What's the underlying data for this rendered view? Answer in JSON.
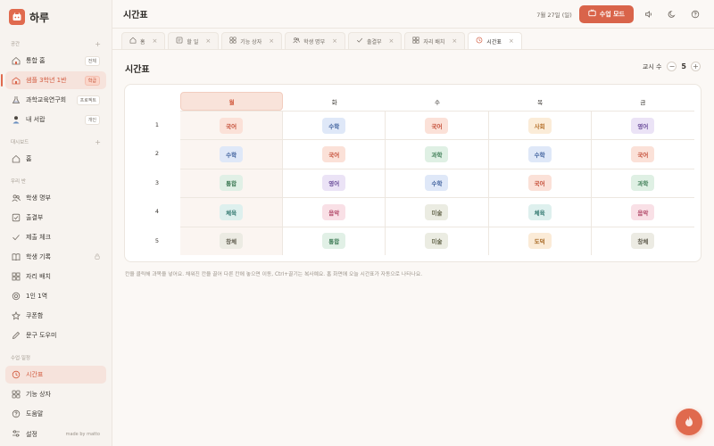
{
  "app": {
    "name": "하루"
  },
  "sidebar": {
    "sections": [
      {
        "title": "공간",
        "items": [
          {
            "label": "통합 홈",
            "tag": "전체",
            "icon": "home-multi-icon"
          },
          {
            "label": "샘플 3학년 1반",
            "tag": "학급",
            "icon": "school-icon"
          },
          {
            "label": "과학교육연구회",
            "tag": "프로젝트",
            "icon": "flask-icon"
          },
          {
            "label": "내 서랍",
            "tag": "개인",
            "icon": "person-icon"
          }
        ]
      },
      {
        "title": "대시보드",
        "items": [
          {
            "label": "홈",
            "icon": "home-icon"
          }
        ]
      },
      {
        "title": "우리 반",
        "items": [
          {
            "label": "학생 명부",
            "icon": "users-icon"
          },
          {
            "label": "출결부",
            "icon": "check-square-icon"
          },
          {
            "label": "제출 체크",
            "icon": "check-icon"
          },
          {
            "label": "학생 기록",
            "icon": "book-icon"
          },
          {
            "label": "자리 배치",
            "icon": "grid-icon"
          },
          {
            "label": "1인 1역",
            "icon": "target-icon"
          },
          {
            "label": "쿠폰함",
            "icon": "star-icon"
          },
          {
            "label": "문구 도우미",
            "icon": "pencil-icon"
          }
        ]
      },
      {
        "title": "수업·일정",
        "items": [
          {
            "label": "시간표",
            "icon": "clock-icon"
          },
          {
            "label": "기능 상자",
            "icon": "apps-icon"
          },
          {
            "label": "도움말",
            "icon": "help-icon"
          }
        ]
      }
    ],
    "footer": {
      "settings": "설정",
      "made_by": "made by matto"
    }
  },
  "topbar": {
    "title": "시간표",
    "date": "7월 27일 (일)",
    "class_mode": "수업 모드"
  },
  "tabs": [
    {
      "label": "홈",
      "icon": "home-icon",
      "active": false
    },
    {
      "label": "할 일",
      "icon": "todo-icon",
      "active": false
    },
    {
      "label": "기능 상자",
      "icon": "apps-icon",
      "active": false
    },
    {
      "label": "학생 명부",
      "icon": "users-icon",
      "active": false
    },
    {
      "label": "출결부",
      "icon": "check-icon",
      "active": false
    },
    {
      "label": "자리 배치",
      "icon": "grid-icon",
      "active": false
    },
    {
      "label": "시간표",
      "icon": "clock-icon",
      "active": true
    }
  ],
  "main": {
    "title": "시간표",
    "period_label": "교시 수",
    "period_count": "5",
    "minus": "−",
    "plus": "+",
    "note": "칸을 클릭해 과목을 넣어요. 채워진 칸을 끌어 다른 칸에 놓으면 이동, Ctrl+끌기는 복사예요. 홈 화면에 오늘 시간표가 자동으로 나타나요."
  },
  "timetable": {
    "days": [
      "월",
      "화",
      "수",
      "목",
      "금"
    ],
    "periods": [
      "1",
      "2",
      "3",
      "4",
      "5"
    ],
    "rows": [
      [
        "국어",
        "수학",
        "국어",
        "사회",
        "영어"
      ],
      [
        "수학",
        "국어",
        "과학",
        "수학",
        "국어"
      ],
      [
        "통합",
        "영어",
        "수학",
        "국어",
        "과학"
      ],
      [
        "체육",
        "음악",
        "미술",
        "체육",
        "음악"
      ],
      [
        "창체",
        "통합",
        "미술",
        "도덕",
        "창체"
      ]
    ]
  },
  "subject_colors": {
    "국어": {
      "bg": "#fbe1d8",
      "fg": "#c5503a"
    },
    "수학": {
      "bg": "#dfe8f8",
      "fg": "#3d5f9c"
    },
    "영어": {
      "bg": "#ebe3f6",
      "fg": "#6b4e9b"
    },
    "사회": {
      "bg": "#fbecd8",
      "fg": "#b5702a"
    },
    "과학": {
      "bg": "#dff0e4",
      "fg": "#3a7a52"
    },
    "통합": {
      "bg": "#e1f0e6",
      "fg": "#3d7a55"
    },
    "체육": {
      "bg": "#def0ee",
      "fg": "#357a72"
    },
    "음악": {
      "bg": "#f9e0e6",
      "fg": "#b04666"
    },
    "미술": {
      "bg": "#ebece2",
      "fg": "#6a6b52"
    },
    "창체": {
      "bg": "#ecebe3",
      "fg": "#5f5c4e"
    },
    "도덕": {
      "bg": "#fbebd7",
      "fg": "#a86a26"
    }
  },
  "colors": {
    "accent": "#d9644a"
  }
}
